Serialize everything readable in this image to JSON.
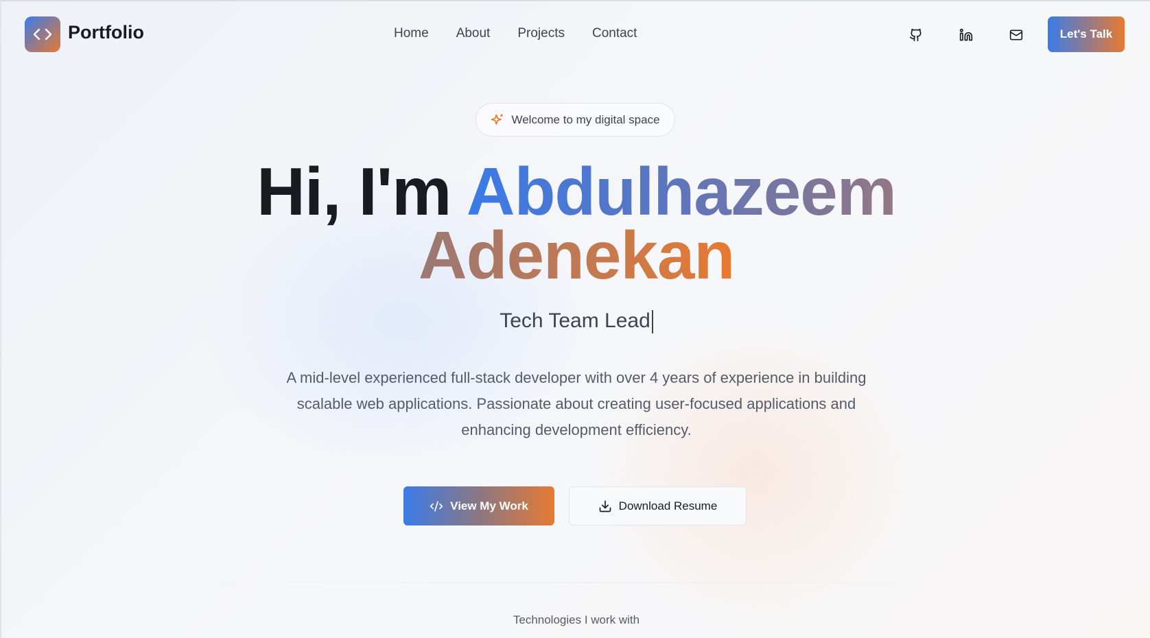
{
  "header": {
    "brand": "Portfolio",
    "nav": [
      "Home",
      "About",
      "Projects",
      "Contact"
    ],
    "cta": "Let's Talk",
    "social_icons": [
      "github-icon",
      "linkedin-icon",
      "mail-icon"
    ]
  },
  "hero": {
    "badge": "Welcome to my digital space",
    "greeting": "Hi, I'm",
    "name_first": "Abdulhazeem",
    "name_last": "Adenekan",
    "role": "Tech Team Lead",
    "description": "A mid-level experienced full-stack developer with over 4 years of experience in building scalable web applications. Passionate about creating user-focused applications and enhancing development efficiency.",
    "primary_button": "View My Work",
    "secondary_button": "Download Resume"
  },
  "technologies_label": "Technologies I work with",
  "colors": {
    "gradient_start": "#3b7be8",
    "gradient_end": "#e67a32"
  }
}
